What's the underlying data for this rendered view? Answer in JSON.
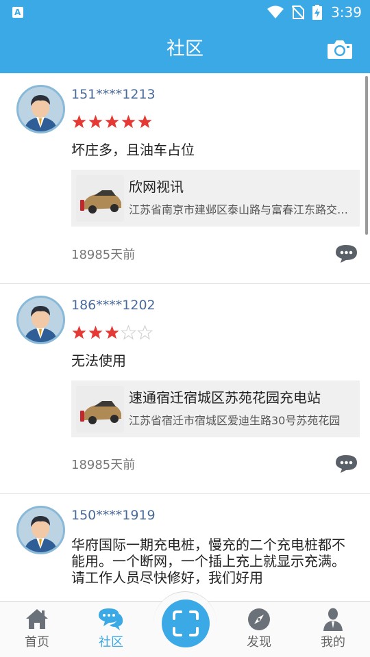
{
  "status_bar": {
    "time": "3:39",
    "left_icon": "A",
    "icons": [
      "wifi-icon",
      "no-sim-icon",
      "battery-charging-icon"
    ]
  },
  "app_bar": {
    "title": "社区",
    "camera_icon": "camera-icon"
  },
  "colors": {
    "accent": "#3aa9e6",
    "star_filled": "#e53935",
    "username": "#4a6a9a"
  },
  "posts": [
    {
      "username": "151****1213",
      "rating": 5,
      "rating_max": 5,
      "text": "坏庄多，且油车占位",
      "station": {
        "name": "欣网视讯",
        "address": "江苏省南京市建邺区泰山路与富春江东路交叉口"
      },
      "time_ago": "18985天前"
    },
    {
      "username": "186****1202",
      "rating": 3,
      "rating_max": 5,
      "text": "无法使用",
      "station": {
        "name": "速通宿迁宿城区苏苑花园充电站",
        "address": "江苏省宿迁市宿城区爱迪生路30号苏苑花园"
      },
      "time_ago": "18985天前"
    },
    {
      "username": "150****1919",
      "rating": 0,
      "rating_max": 0,
      "text_lines": [
        "华府国际一期充电桩，慢充的二个充电桩都不",
        "能用。一个断网，一个插上充上就显示充满。",
        "请工作人员尽快修好，我们好用"
      ]
    }
  ],
  "bottom_nav": {
    "items": [
      {
        "label": "首页",
        "icon": "home-icon",
        "active": false
      },
      {
        "label": "社区",
        "icon": "chat-bubbles-icon",
        "active": true
      },
      {
        "label": "发现",
        "icon": "compass-icon",
        "active": false
      },
      {
        "label": "我的",
        "icon": "person-icon",
        "active": false
      }
    ],
    "center_icon": "scan-icon"
  }
}
